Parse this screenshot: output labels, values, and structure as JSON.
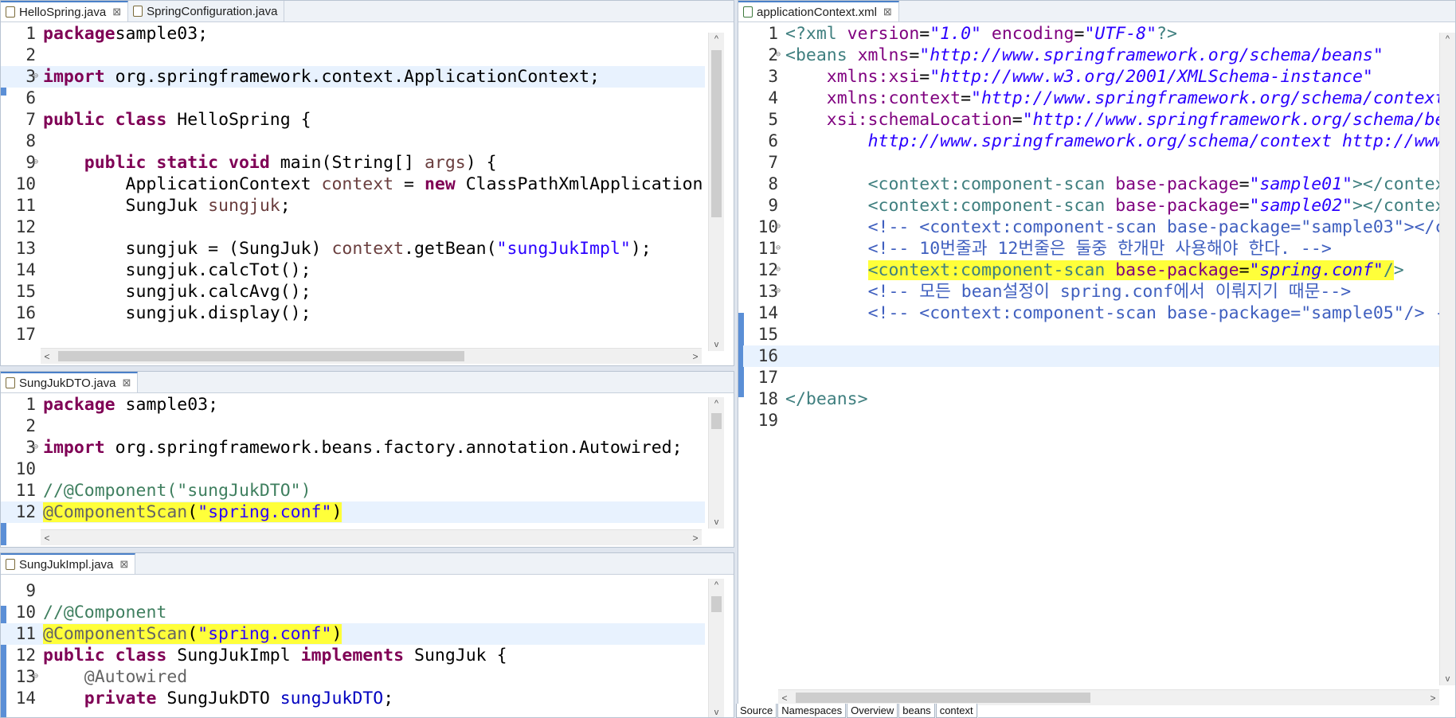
{
  "top_left": {
    "tabs": [
      {
        "label": "HelloSpring.java",
        "close": "⊠"
      },
      {
        "label": "SpringConfiguration.java"
      }
    ],
    "lines": [
      {
        "n": "1",
        "parts": [
          [
            "kw",
            "package"
          ],
          [
            "",
            "sample03;"
          ]
        ]
      },
      {
        "n": "2",
        "parts": []
      },
      {
        "n": "3",
        "parts": [
          [
            "kw",
            "import"
          ],
          [
            "",
            " org.springframework.context.ApplicationContext;"
          ]
        ]
      },
      {
        "n": "6",
        "parts": []
      },
      {
        "n": "7",
        "parts": [
          [
            "kw",
            "public class"
          ],
          [
            "",
            " HelloSpring {"
          ]
        ]
      },
      {
        "n": "8",
        "parts": []
      },
      {
        "n": "9",
        "parts": [
          [
            "",
            "    "
          ],
          [
            "kw",
            "public static void"
          ],
          [
            "",
            " main(String[] "
          ],
          [
            "var",
            "args"
          ],
          [
            "",
            ") {"
          ]
        ]
      },
      {
        "n": "10",
        "parts": [
          [
            "",
            "        ApplicationContext "
          ],
          [
            "var",
            "context"
          ],
          [
            "",
            " = "
          ],
          [
            "kw",
            "new"
          ],
          [
            "",
            " ClassPathXmlApplication"
          ]
        ]
      },
      {
        "n": "11",
        "parts": [
          [
            "",
            "        SungJuk "
          ],
          [
            "var",
            "sungjuk"
          ],
          [
            "",
            ";"
          ]
        ]
      },
      {
        "n": "12",
        "parts": []
      },
      {
        "n": "13",
        "parts": [
          [
            "",
            "        sungjuk = (SungJuk) "
          ],
          [
            "var",
            "context"
          ],
          [
            "",
            ".getBean("
          ],
          [
            "str",
            "\"sungJukImpl\""
          ],
          [
            "",
            ");"
          ]
        ]
      },
      {
        "n": "14",
        "parts": [
          [
            "",
            "        sungjuk.calcTot();"
          ]
        ]
      },
      {
        "n": "15",
        "parts": [
          [
            "",
            "        sungjuk.calcAvg();"
          ]
        ]
      },
      {
        "n": "16",
        "parts": [
          [
            "",
            "        sungjuk.display();"
          ]
        ]
      },
      {
        "n": "17",
        "parts": []
      }
    ]
  },
  "mid_left": {
    "tab": {
      "label": "SungJukDTO.java",
      "close": "⊠"
    },
    "lines": [
      {
        "n": "1",
        "parts": [
          [
            "kw",
            "package"
          ],
          [
            "",
            " sample03;"
          ]
        ]
      },
      {
        "n": "2",
        "parts": []
      },
      {
        "n": "3",
        "parts": [
          [
            "kw",
            "import"
          ],
          [
            "",
            " org.springframework.beans.factory.annotation.Autowired;"
          ]
        ]
      },
      {
        "n": "10",
        "parts": []
      },
      {
        "n": "11",
        "parts": [
          [
            "cm",
            "//@Component(\"sungJukDTO\")"
          ]
        ]
      },
      {
        "n": "12",
        "parts": [
          [
            "ann hl",
            "@ComponentScan"
          ],
          [
            "hl",
            "("
          ],
          [
            "str hl",
            "\"spring.conf\""
          ],
          [
            "hl",
            ")"
          ]
        ]
      }
    ]
  },
  "bot_left": {
    "tab": {
      "label": "SungJukImpl.java",
      "close": "⊠"
    },
    "lines": [
      {
        "n": "9",
        "parts": []
      },
      {
        "n": "10",
        "parts": [
          [
            "cm",
            "//@Component"
          ]
        ]
      },
      {
        "n": "11",
        "parts": [
          [
            "ann hl",
            "@ComponentScan"
          ],
          [
            "hl",
            "("
          ],
          [
            "str hl",
            "\"spring.conf\""
          ],
          [
            "hl",
            ")"
          ]
        ]
      },
      {
        "n": "12",
        "parts": [
          [
            "kw",
            "public class"
          ],
          [
            "",
            " SungJukImpl "
          ],
          [
            "kw",
            "implements"
          ],
          [
            "",
            " SungJuk {"
          ]
        ]
      },
      {
        "n": "13",
        "parts": [
          [
            "",
            "    "
          ],
          [
            "ann",
            "@Autowired"
          ]
        ]
      },
      {
        "n": "14",
        "parts": [
          [
            "",
            "    "
          ],
          [
            "kw",
            "private"
          ],
          [
            "",
            " SungJukDTO "
          ],
          [
            "fld",
            "sungJukDTO"
          ],
          [
            "",
            ";"
          ]
        ]
      }
    ]
  },
  "right": {
    "tab": {
      "label": "applicationContext.xml",
      "close": "⊠"
    },
    "lines": [
      {
        "n": "1",
        "parts": [
          [
            "xtag",
            "<?xml "
          ],
          [
            "xattr",
            "version"
          ],
          [
            "",
            "="
          ],
          [
            "xval",
            "\"1.0\""
          ],
          [
            "",
            " "
          ],
          [
            "xattr",
            "encoding"
          ],
          [
            "",
            "="
          ],
          [
            "xval",
            "\"UTF-8\""
          ],
          [
            "xtag",
            "?>"
          ]
        ]
      },
      {
        "n": "2",
        "parts": [
          [
            "xtag",
            "<beans "
          ],
          [
            "xattr",
            "xmlns"
          ],
          [
            "",
            "="
          ],
          [
            "xval",
            "\"http://www.springframework.org/schema/beans\""
          ]
        ]
      },
      {
        "n": "3",
        "parts": [
          [
            "",
            "    "
          ],
          [
            "xattr",
            "xmlns:xsi"
          ],
          [
            "",
            "="
          ],
          [
            "xval",
            "\"http://www.w3.org/2001/XMLSchema-instance\""
          ]
        ]
      },
      {
        "n": "4",
        "parts": [
          [
            "",
            "    "
          ],
          [
            "xattr",
            "xmlns:context"
          ],
          [
            "",
            "="
          ],
          [
            "xval",
            "\"http://www.springframework.org/schema/context"
          ]
        ]
      },
      {
        "n": "5",
        "parts": [
          [
            "",
            "    "
          ],
          [
            "xattr",
            "xsi:schemaLocation"
          ],
          [
            "",
            "="
          ],
          [
            "xval",
            "\"http://www.springframework.org/schema/be"
          ]
        ]
      },
      {
        "n": "6",
        "parts": [
          [
            "",
            "        "
          ],
          [
            "xval",
            "http://www.springframework.org/schema/context http://www"
          ]
        ]
      },
      {
        "n": "7",
        "parts": []
      },
      {
        "n": "8",
        "parts": [
          [
            "",
            "        "
          ],
          [
            "xtag",
            "<context:component-scan "
          ],
          [
            "xattr",
            "base-package"
          ],
          [
            "",
            "="
          ],
          [
            "xval",
            "\"sample01\""
          ],
          [
            "xtag",
            "></contex"
          ]
        ]
      },
      {
        "n": "9",
        "parts": [
          [
            "",
            "        "
          ],
          [
            "xtag",
            "<context:component-scan "
          ],
          [
            "xattr",
            "base-package"
          ],
          [
            "",
            "="
          ],
          [
            "xval",
            "\"sample02\""
          ],
          [
            "xtag",
            "></contex"
          ]
        ]
      },
      {
        "n": "10",
        "parts": [
          [
            "",
            "        "
          ],
          [
            "xcm",
            "<!-- <context:component-scan base-package=\"sample03\"></c"
          ]
        ]
      },
      {
        "n": "11",
        "parts": [
          [
            "",
            "        "
          ],
          [
            "xcm",
            "<!-- 10번줄과 12번줄은 둘중 한개만 사용해야 한다. -->"
          ]
        ]
      },
      {
        "n": "12",
        "parts": [
          [
            "",
            "        "
          ],
          [
            "xtag hl",
            "<context:component-scan "
          ],
          [
            "xattr hl",
            "base-package"
          ],
          [
            "hl",
            "="
          ],
          [
            "xval hl",
            "\"spring.conf\""
          ],
          [
            "xtag hl",
            "/"
          ],
          [
            "xtag",
            ">"
          ]
        ]
      },
      {
        "n": "13",
        "parts": [
          [
            "",
            "        "
          ],
          [
            "xcm",
            "<!-- 모든 bean설정이 spring.conf에서 이뤄지기 때문-->"
          ]
        ]
      },
      {
        "n": "14",
        "parts": [
          [
            "",
            "        "
          ],
          [
            "xcm",
            "<!-- <context:component-scan base-package=\"sample05\"/> -"
          ]
        ]
      },
      {
        "n": "15",
        "parts": []
      },
      {
        "n": "16",
        "parts": []
      },
      {
        "n": "17",
        "parts": []
      },
      {
        "n": "18",
        "parts": [
          [
            "xtag",
            "</beans>"
          ]
        ]
      },
      {
        "n": "19",
        "parts": []
      }
    ],
    "bottom_tabs": [
      "Source",
      "Namespaces",
      "Overview",
      "beans",
      "context"
    ]
  }
}
